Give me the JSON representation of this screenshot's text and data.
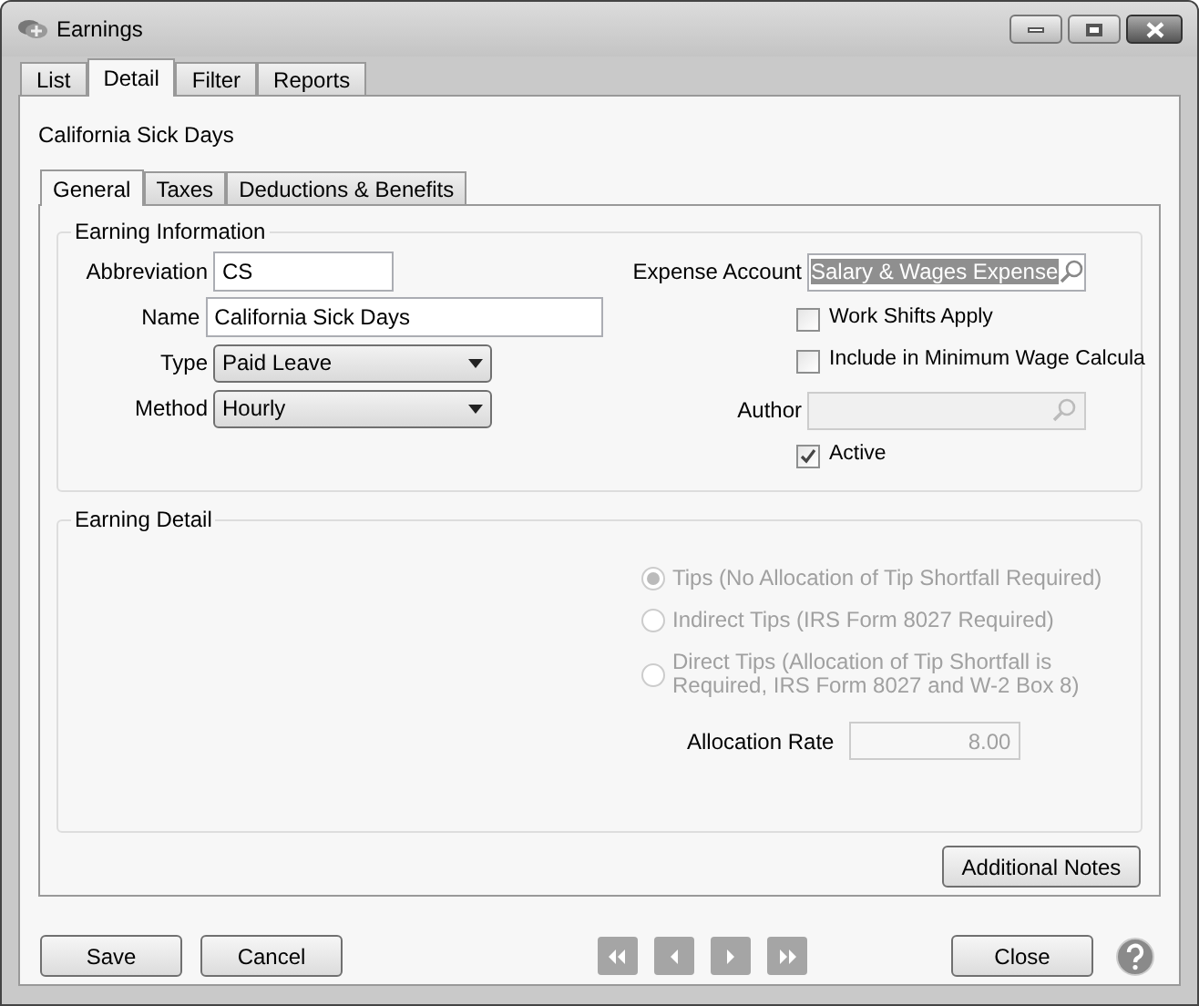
{
  "window": {
    "title": "Earnings"
  },
  "tabs": [
    {
      "label": "List",
      "selected": false
    },
    {
      "label": "Detail",
      "selected": true
    },
    {
      "label": "Filter",
      "selected": false
    },
    {
      "label": "Reports",
      "selected": false
    }
  ],
  "record_title": "California Sick Days",
  "inner_tabs": [
    {
      "label": "General",
      "selected": true
    },
    {
      "label": "Taxes",
      "selected": false
    },
    {
      "label": "Deductions & Benefits",
      "selected": false
    }
  ],
  "earning_information": {
    "title": "Earning Information",
    "left_fields": [
      {
        "label": "Abbreviation",
        "value": "CS",
        "kind": "text"
      },
      {
        "label": "Name",
        "value": "California Sick Days",
        "kind": "text"
      },
      {
        "label": "Type",
        "value": "Paid Leave",
        "kind": "dropdown"
      },
      {
        "label": "Method",
        "value": "Hourly",
        "kind": "dropdown"
      }
    ],
    "expense_account": {
      "label": "Expense Account",
      "value": "Salary & Wages Expense",
      "highlighted": true,
      "disabled": false
    },
    "checkboxes": [
      {
        "label": "Work Shifts Apply",
        "checked": false
      },
      {
        "label": "Include in Minimum Wage Calcula",
        "checked": false
      }
    ],
    "author": {
      "label": "Author",
      "disabled": true
    },
    "active": {
      "label": "Active",
      "checked": true
    }
  },
  "earning_detail": {
    "title": "Earning Detail",
    "radios": [
      {
        "label": "Tips (No Allocation of Tip Shortfall Required)",
        "selected": true,
        "disabled": true
      },
      {
        "label": "Indirect Tips (IRS Form 8027 Required)",
        "selected": false,
        "disabled": true
      },
      {
        "label": "Direct Tips (Allocation of Tip Shortfall is Required, IRS Form 8027 and W-2 Box 8)",
        "selected": false,
        "disabled": true
      }
    ],
    "allocation_rate": {
      "label": "Allocation Rate",
      "value": "8.00",
      "disabled": true
    }
  },
  "notes_button": "Additional Notes",
  "footer": {
    "left_buttons": [
      "Save",
      "Cancel"
    ],
    "nav_disabled": true,
    "right_button": "Close"
  }
}
